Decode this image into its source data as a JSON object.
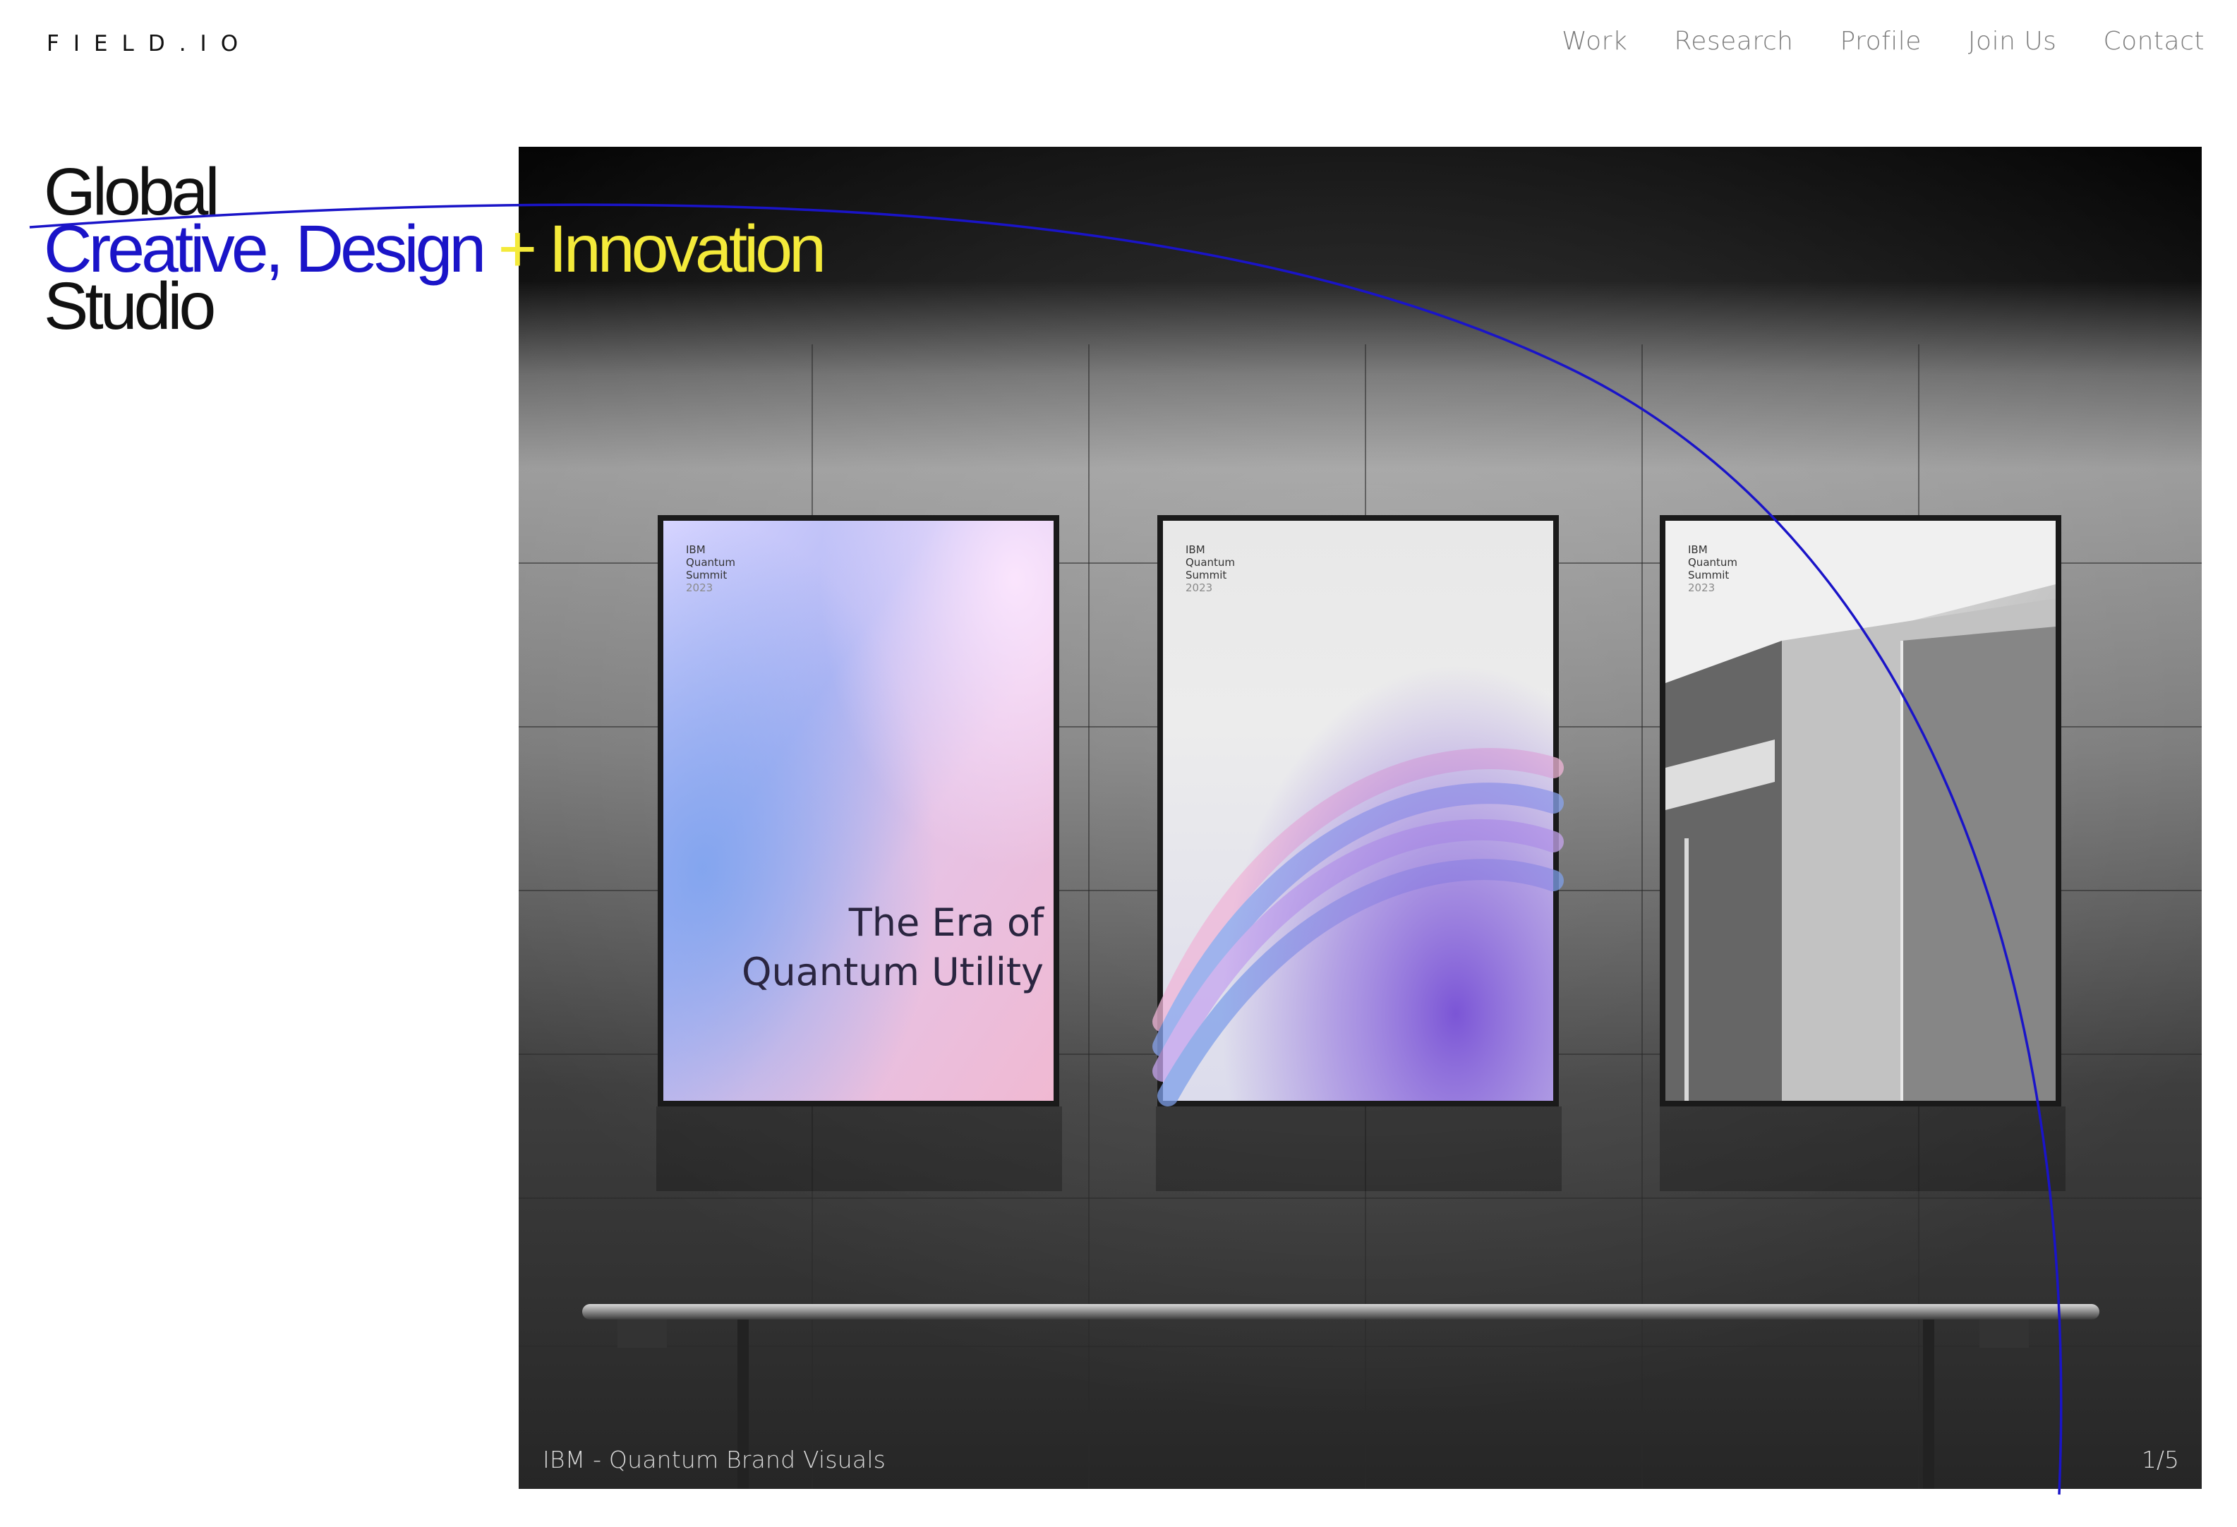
{
  "header": {
    "logo": "FIELD.IO",
    "nav": [
      "Work",
      "Research",
      "Profile",
      "Join Us",
      "Contact"
    ]
  },
  "tagline": {
    "line1": "Global",
    "line2_part1": "Creative, Design",
    "line2_part2": " + Innovation",
    "line3": "Studio"
  },
  "slideshow": {
    "caption": "IBM - Quantum Brand Visuals",
    "counter": "1/5",
    "posters": [
      {
        "brand": "IBM",
        "line2": "Quantum",
        "line3": "Summit",
        "year": "2023"
      },
      {
        "brand": "IBM",
        "line2": "Quantum",
        "line3": "Summit",
        "year": "2023"
      },
      {
        "brand": "IBM",
        "line2": "Quantum",
        "line3": "Summit",
        "year": "2023"
      }
    ],
    "headline_line1": "The Era of",
    "headline_line2": "Quantum Utility"
  },
  "colors": {
    "accent_blue": "#1a14c8",
    "accent_yellow": "#f4ea3a",
    "nav_gray": "#7d7d7d"
  }
}
